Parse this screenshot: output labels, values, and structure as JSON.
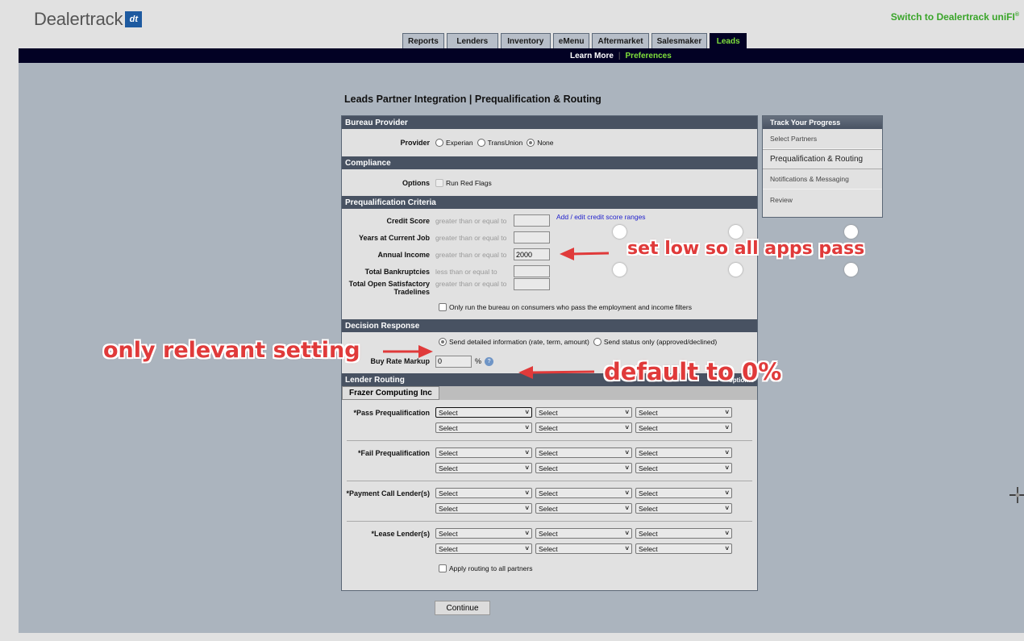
{
  "header": {
    "logo_text": "Dealertrack",
    "logo_mark": "dt",
    "switch_link": "Switch to Dealertrack uniFI",
    "switch_link_sup": "®"
  },
  "tabs": [
    {
      "label": "Reports",
      "active": false
    },
    {
      "label": "Lenders",
      "active": false
    },
    {
      "label": "Inventory",
      "active": false
    },
    {
      "label": "eMenu",
      "active": false
    },
    {
      "label": "Aftermarket",
      "active": false
    },
    {
      "label": "Salesmaker",
      "active": false
    },
    {
      "label": "Leads",
      "active": true
    }
  ],
  "subnav": {
    "learn_more": "Learn More",
    "separator": "|",
    "preferences": "Preferences"
  },
  "page_title": "Leads Partner Integration | Prequalification & Routing",
  "bureau": {
    "heading": "Bureau Provider",
    "label": "Provider",
    "options": [
      {
        "label": "Experian",
        "selected": false
      },
      {
        "label": "TransUnion",
        "selected": false
      },
      {
        "label": "None",
        "selected": true
      }
    ]
  },
  "compliance": {
    "heading": "Compliance",
    "label": "Options",
    "checkbox_label": "Run Red Flags",
    "checked": false,
    "disabled": true
  },
  "criteria": {
    "heading": "Prequalification Criteria",
    "link": "Add / edit credit score ranges",
    "rows": [
      {
        "label": "Credit Score",
        "operator": "greater than or equal to",
        "value": ""
      },
      {
        "label": "Years at Current Job",
        "operator": "greater than or equal to",
        "value": ""
      },
      {
        "label": "Annual Income",
        "operator": "greater than or equal to",
        "value": "2000"
      },
      {
        "label": "Total Bankruptcies",
        "operator": "less than or equal to",
        "value": ""
      },
      {
        "label": "Total Open Satisfactory",
        "label2": "Tradelines",
        "operator": "greater than or equal to",
        "value": ""
      }
    ],
    "only_run_label": "Only run the bureau on consumers who pass the employment and income filters"
  },
  "decision": {
    "heading": "Decision Response",
    "options": [
      {
        "label": "Send detailed information (rate, term, amount)",
        "selected": true
      },
      {
        "label": "Send status only (approved/declined)",
        "selected": false
      }
    ],
    "markup_label": "Buy Rate Markup",
    "markup_value": "0",
    "markup_unit": "%",
    "help_icon": "?"
  },
  "routing": {
    "heading": "Lender Routing",
    "optional_note": "* optional",
    "partner_tab": "Frazer Computing Inc",
    "select_placeholder": "Select",
    "groups": [
      {
        "label": "*Pass Prequalification"
      },
      {
        "label": "*Fail Prequalification"
      },
      {
        "label": "*Payment Call Lender(s)"
      },
      {
        "label": "*Lease Lender(s)"
      }
    ],
    "apply_all_label": "Apply routing to all partners"
  },
  "continue_label": "Continue",
  "progress": {
    "heading": "Track Your Progress",
    "steps": [
      {
        "label": "Select Partners",
        "current": false
      },
      {
        "label": "Prequalification & Routing",
        "current": true
      },
      {
        "label": "Notifications & Messaging",
        "current": false
      },
      {
        "label": "Review",
        "current": false
      }
    ]
  },
  "annotations": {
    "set_low": "set low so all apps pass",
    "only_relevant": "only relevant setting",
    "default_zero": "default to 0%"
  }
}
